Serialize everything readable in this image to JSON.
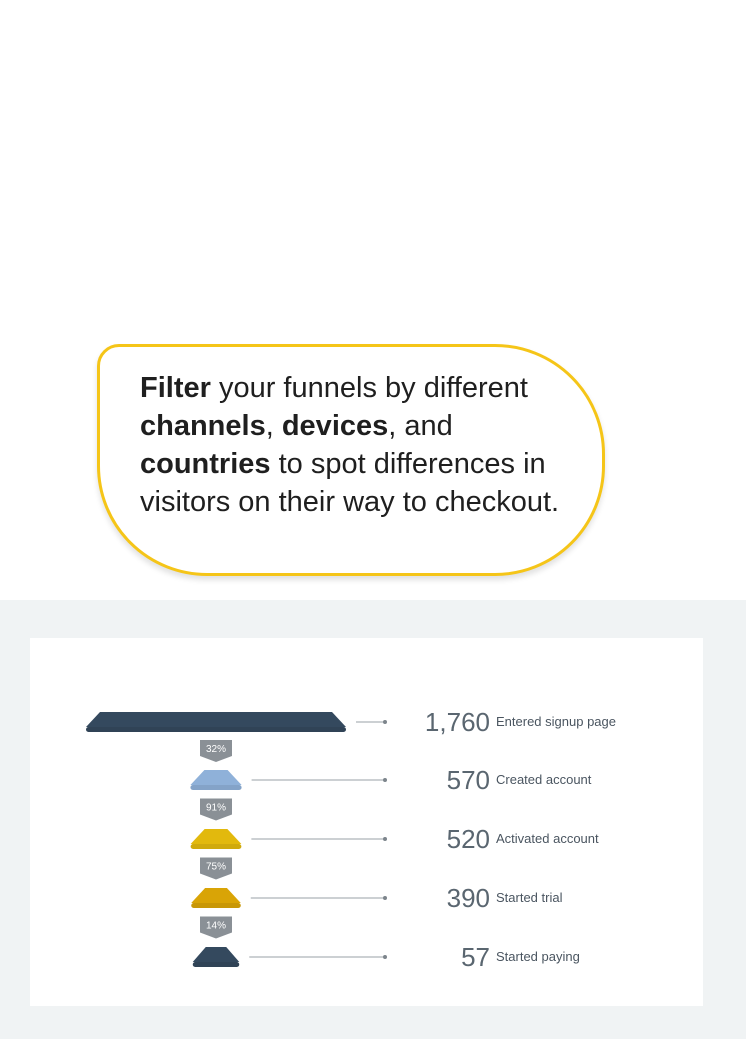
{
  "callout": {
    "segments": [
      {
        "text": "Filter",
        "bold": true
      },
      {
        "text": " your funnels by different ",
        "bold": false
      },
      {
        "text": "channels",
        "bold": true
      },
      {
        "text": ", ",
        "bold": false
      },
      {
        "text": "devices",
        "bold": true
      },
      {
        "text": ", and ",
        "bold": false
      },
      {
        "text": "countries",
        "bold": true
      },
      {
        "text": " to spot differences in visitors on their way to checkout.",
        "bold": false
      }
    ],
    "border_color": "#f5c518"
  },
  "chart_data": {
    "type": "funnel",
    "stages": [
      {
        "label": "Entered signup page",
        "value_text": "1,760",
        "value": 1760,
        "color": "#34495e"
      },
      {
        "label": "Created account",
        "value_text": "570",
        "value": 570,
        "color": "#8fb1d9"
      },
      {
        "label": "Activated account",
        "value_text": "520",
        "value": 520,
        "color": "#e2b90d"
      },
      {
        "label": "Started trial",
        "value_text": "390",
        "value": 390,
        "color": "#d9a406"
      },
      {
        "label": "Started paying",
        "value_text": "57",
        "value": 57,
        "color": "#34495e"
      }
    ],
    "conversions": [
      "32%",
      "91%",
      "75%",
      "14%"
    ],
    "connector_color": "#8a9096"
  }
}
